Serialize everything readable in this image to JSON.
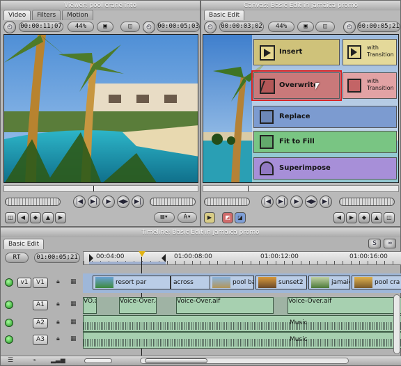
{
  "viewer": {
    "window_title": "Viewer: pool crane into",
    "tabs": [
      "Video",
      "Filters",
      "Motion"
    ],
    "timecode_duration": "00:00:11;07",
    "zoom": "44%",
    "timecode_current": "00:00:05;03"
  },
  "canvas": {
    "window_title": "Canvas: Basic Edit in jamaica promo",
    "tab": "Basic Edit",
    "timecode_duration": "00:00:03;02",
    "zoom": "44%",
    "timecode_current": "00:00:05;21"
  },
  "edit_overlay": {
    "insert": "Insert",
    "insert_with_transition": "with Transition",
    "overwrite": "Overwrite",
    "overwrite_with_transition": "with Transition",
    "replace": "Replace",
    "fit_to_fill": "Fit to Fill",
    "superimpose": "Superimpose",
    "colors": {
      "insert": "#cfc27a",
      "overwrite": "#c9797a",
      "replace": "#7c9bd0",
      "fit_to_fill": "#79c583",
      "superimpose": "#a78fd8",
      "highlight": "#d81f1f"
    }
  },
  "timeline": {
    "window_title": "Timeline: Basic Edit in jamaica promo",
    "tab": "Basic Edit",
    "rt_label": "RT",
    "timecode": "01:00:05;21",
    "ruler": [
      "00:04:00",
      "01:00:08:00",
      "01:00:12:00",
      "01:00:16:00"
    ],
    "tracks": {
      "v1_src": "v1",
      "v1_dst": "V1",
      "a1": "A1",
      "a2": "A2",
      "a3": "A3"
    },
    "video_clips": [
      "resort par",
      "across",
      "pool bar",
      "sunset2",
      "jamaica",
      "pool cra"
    ],
    "a1_clips": [
      "VO.a",
      "Voice-Over.a",
      "Voice-Over.aif",
      "Voice-Over.aif"
    ],
    "music_clips": [
      "Music",
      "Music"
    ]
  }
}
